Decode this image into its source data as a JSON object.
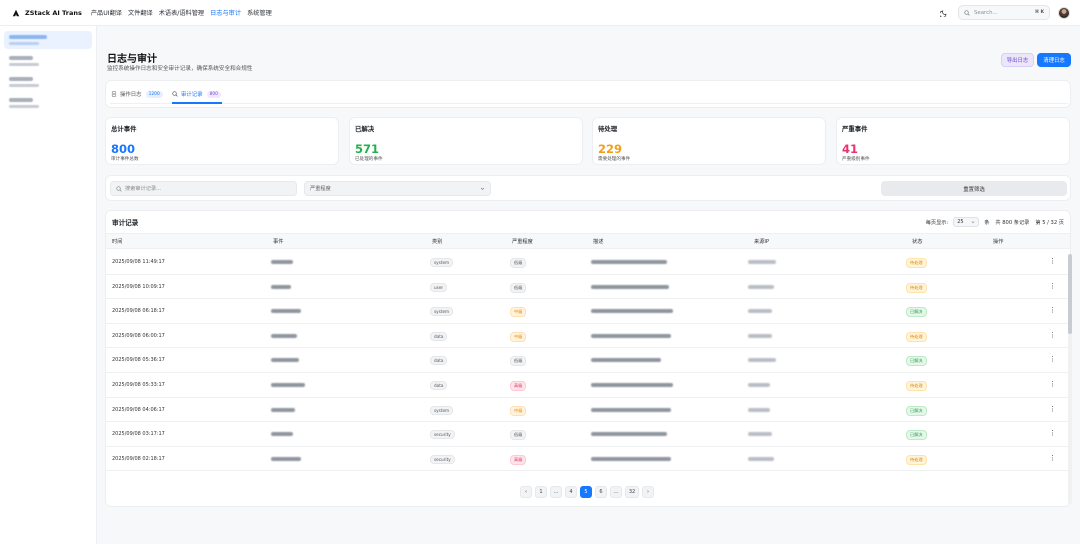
{
  "app": {
    "name": "ZStack AI Trans"
  },
  "nav": [
    "产品UI翻译",
    "文件翻译",
    "术语表/语料管理",
    "日志与审计",
    "系统管理"
  ],
  "nav_active": 3,
  "search": {
    "placeholder": "Search...",
    "shortcut": "⌘ K"
  },
  "page": {
    "title": "日志与审计",
    "subtitle": "监控系统操作日志和安全审计记录，确保系统安全和合规性",
    "export_label": "导出日志",
    "clean_label": "清理日志"
  },
  "tabs": [
    {
      "label": "操作日志",
      "count": "1200"
    },
    {
      "label": "审计记录",
      "count": "800"
    }
  ],
  "stats": [
    {
      "label": "总计事件",
      "value": "800",
      "desc": "审计事件总数",
      "color": "#1677ff"
    },
    {
      "label": "已解决",
      "value": "571",
      "desc": "已处理的事件",
      "color": "#22b14c"
    },
    {
      "label": "待处理",
      "value": "229",
      "desc": "需要处理的事件",
      "color": "#f0a020"
    },
    {
      "label": "严重事件",
      "value": "41",
      "desc": "严重级别事件",
      "color": "#e8336e"
    }
  ],
  "filters": {
    "search_placeholder": "搜索审计记录...",
    "severity_placeholder": "严重程度",
    "reset_label": "重置筛选"
  },
  "table": {
    "title": "审计记录",
    "per_page_label": "每页显示:",
    "per_page_value": "25",
    "unit": "条",
    "total": "共 800 条记录",
    "page_info": "第 5 / 32 页",
    "columns": [
      "时间",
      "事件",
      "类别",
      "严重程度",
      "描述",
      "来源IP",
      "状态",
      "操作"
    ],
    "rows": [
      {
        "time": "2025/09/08 11:49:17",
        "category": "system",
        "severity": "低级",
        "status": "待处理"
      },
      {
        "time": "2025/09/08 10:09:17",
        "category": "user",
        "severity": "低级",
        "status": "待处理"
      },
      {
        "time": "2025/09/08 06:18:17",
        "category": "system",
        "severity": "中级",
        "status": "已解决"
      },
      {
        "time": "2025/09/08 06:00:17",
        "category": "data",
        "severity": "中级",
        "status": "待处理"
      },
      {
        "time": "2025/09/08 05:36:17",
        "category": "data",
        "severity": "低级",
        "status": "已解决"
      },
      {
        "time": "2025/09/08 05:33:17",
        "category": "data",
        "severity": "高级",
        "status": "待处理"
      },
      {
        "time": "2025/09/08 04:06:17",
        "category": "system",
        "severity": "中级",
        "status": "已解决"
      },
      {
        "time": "2025/09/08 03:17:17",
        "category": "security",
        "severity": "低级",
        "status": "已解决"
      },
      {
        "time": "2025/09/08 02:18:17",
        "category": "security",
        "severity": "高级",
        "status": "待处理"
      }
    ]
  },
  "pagination": [
    "‹",
    "1",
    "…",
    "4",
    "5",
    "6",
    "…",
    "32",
    "›"
  ],
  "pagination_active": 4,
  "colors": {
    "accent": "#1677ff",
    "sev_low_bg": "#f2f3f5",
    "sev_mid_bg": "#fff3e0",
    "sev_high_bg": "#ffe4ea",
    "pending_bg": "#fff4dc",
    "resolved_bg": "#e6f7ea"
  }
}
